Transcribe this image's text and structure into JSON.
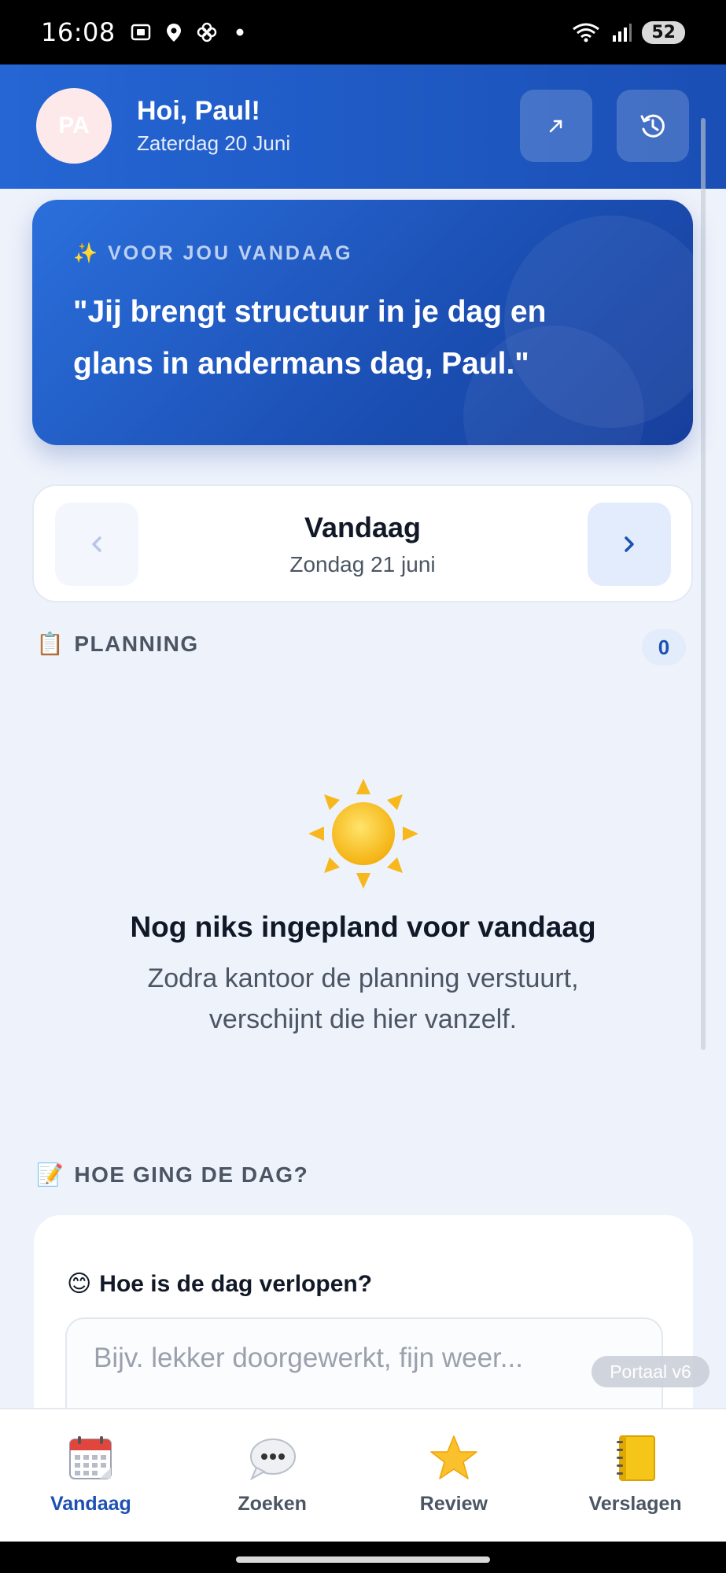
{
  "status_bar": {
    "time": "16:08",
    "battery": "52"
  },
  "header": {
    "avatar_initials": "PA",
    "greeting": "Hoi, Paul!",
    "date": "Zaterdag 20 Juni"
  },
  "quote_card": {
    "label": "✨ VOOR JOU VANDAAG",
    "quote": "\"Jij brengt structuur in je dag en glans in andermans dag, Paul.\""
  },
  "day_nav": {
    "title": "Vandaag",
    "subtitle": "Zondag 21 juni"
  },
  "planning": {
    "emoji": "📋",
    "heading": "PLANNING",
    "count": "0",
    "empty_title": "Nog niks ingepland voor vandaag",
    "empty_desc": "Zodra kantoor de planning verstuurt, verschijnt die hier vanzelf."
  },
  "review": {
    "emoji": "📝",
    "heading": "HOE GING DE DAG?",
    "question_emoji": "😊",
    "question": "Hoe is de dag verlopen?",
    "placeholder": "Bijv. lekker doorgewerkt, fijn weer..."
  },
  "portal_chip": "Portaal v6",
  "bottom_nav": [
    {
      "label": "Vandaag",
      "icon": "calendar-icon",
      "active": true
    },
    {
      "label": "Zoeken",
      "icon": "speech-bubble-icon",
      "active": false
    },
    {
      "label": "Review",
      "icon": "star-icon",
      "active": false
    },
    {
      "label": "Verslagen",
      "icon": "notebook-icon",
      "active": false
    }
  ],
  "colors": {
    "primary": "#1d4fb3",
    "header_blue": "#2566d4",
    "background": "#eef2fb"
  }
}
